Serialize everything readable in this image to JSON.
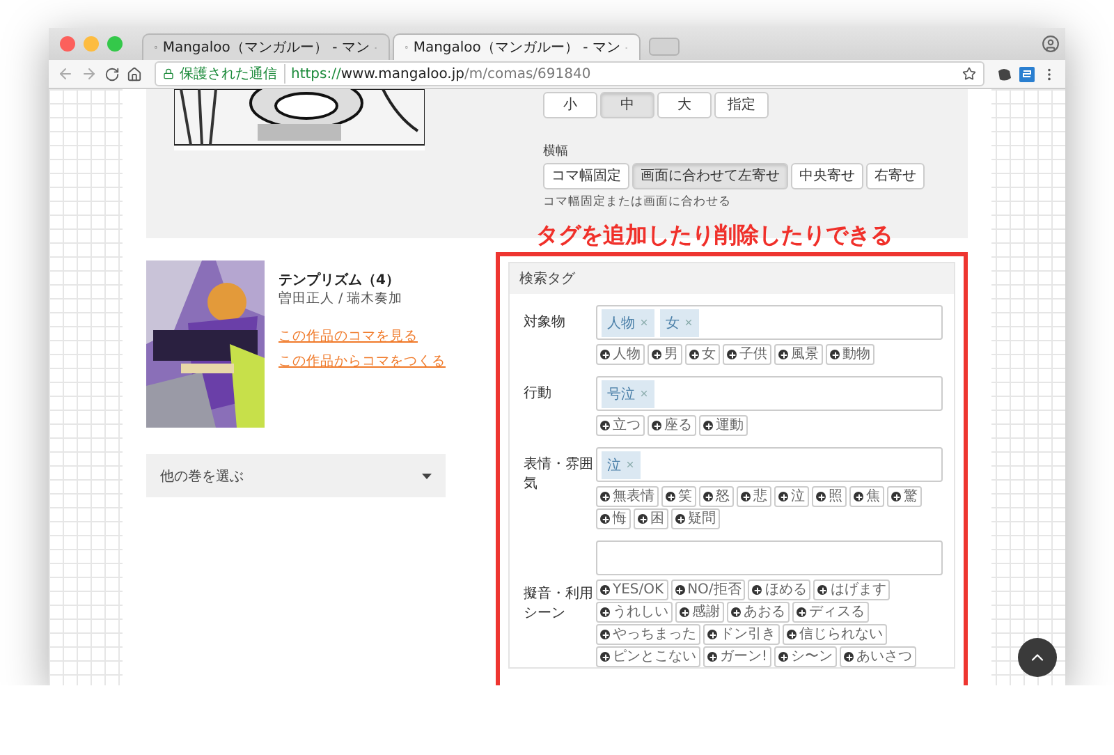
{
  "browser": {
    "tabs": [
      {
        "title": "Mangaloo（マンガルー） - マン",
        "selected": false
      },
      {
        "title": "Mangaloo（マンガルー） - マン",
        "selected": true
      }
    ],
    "security": "保護された通信",
    "url_scheme": "https://",
    "url_host": "www.mangaloo.jp",
    "url_path": "/m/comas/691840"
  },
  "size_buttons": [
    {
      "label": "小",
      "selected": false
    },
    {
      "label": "中",
      "selected": true
    },
    {
      "label": "大",
      "selected": false
    },
    {
      "label": "指定",
      "selected": false
    }
  ],
  "width_setting": {
    "label": "横幅",
    "buttons": [
      {
        "label": "コマ幅固定",
        "selected": false
      },
      {
        "label": "画面に合わせて左寄せ",
        "selected": true
      },
      {
        "label": "中央寄せ",
        "selected": false
      },
      {
        "label": "右寄せ",
        "selected": false
      }
    ],
    "hint": "コマ幅固定または画面に合わせる"
  },
  "annotation": "タグを追加したり削除したりできる",
  "book": {
    "title": "テンプリズム（4）",
    "authors": "曽田正人 / 瑞木奏加",
    "links": [
      "この作品のコマを見る",
      "この作品からコマをつくる"
    ]
  },
  "volume_select": "他の巻を選ぶ",
  "tag_panel": {
    "title": "検索タグ",
    "groups": [
      {
        "label": "対象物",
        "tags": [
          "人物",
          "女"
        ],
        "suggestions": [
          "人物",
          "男",
          "女",
          "子供",
          "風景",
          "動物"
        ]
      },
      {
        "label": "行動",
        "tags": [
          "号泣"
        ],
        "suggestions": [
          "立つ",
          "座る",
          "運動"
        ]
      },
      {
        "label": "表情・雰囲気",
        "tags": [
          "泣"
        ],
        "suggestions": [
          "無表情",
          "笑",
          "怒",
          "悲",
          "泣",
          "照",
          "焦",
          "驚",
          "悔",
          "困",
          "疑問"
        ]
      },
      {
        "label": "擬音・利用シーン",
        "suggestions": [
          "YES/OK",
          "NO/拒否",
          "ほめる",
          "はげます",
          "うれしい",
          "感謝",
          "あおる",
          "ディスる",
          "やっちまった",
          "ドン引き",
          "信じられない",
          "ピンとこない",
          "ガーン!",
          "シ〜ン",
          "あいさつ"
        ]
      }
    ]
  }
}
